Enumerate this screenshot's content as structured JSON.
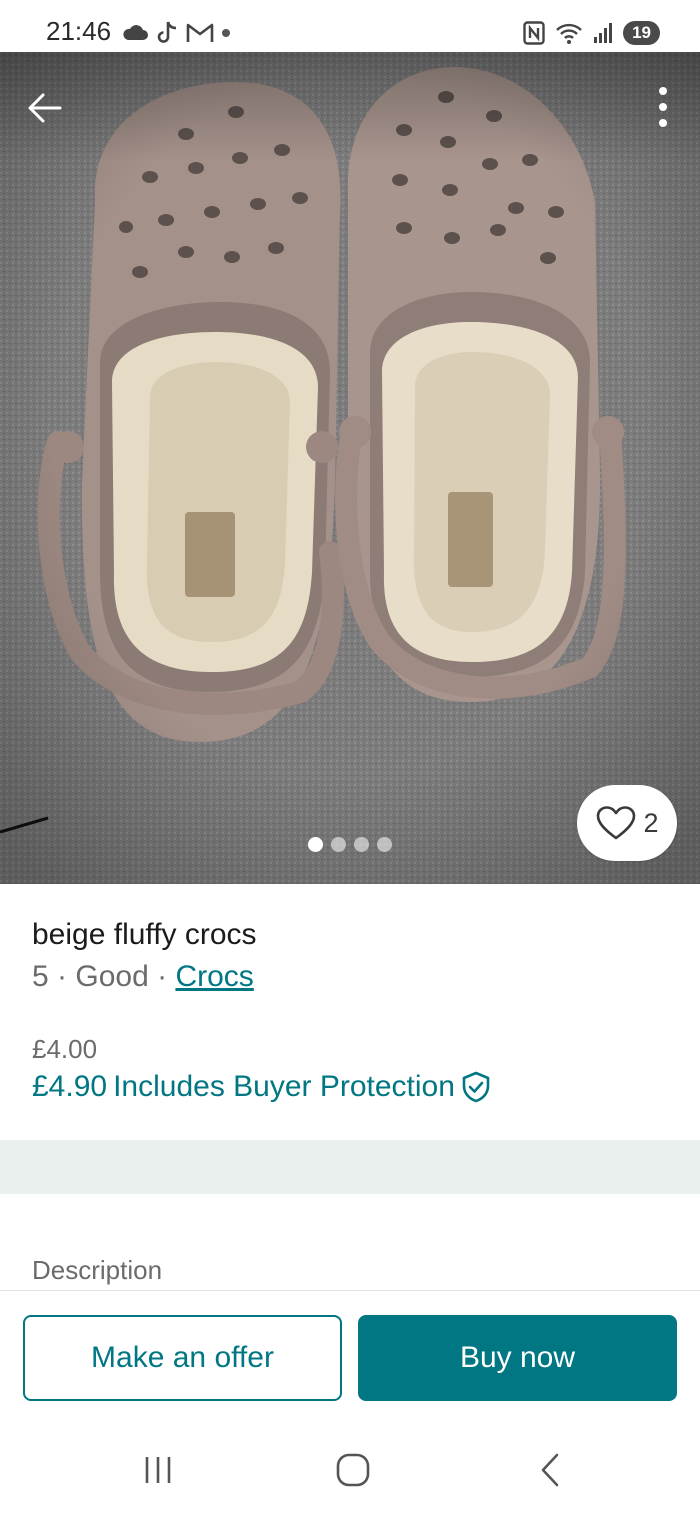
{
  "status_bar": {
    "time": "21:46",
    "left_icons": [
      "cloud-icon",
      "tiktok-icon",
      "gmail-icon",
      "dot-icon"
    ],
    "right_icons": [
      "nfc-icon",
      "wifi-icon",
      "signal-icon"
    ],
    "battery": "19"
  },
  "photo": {
    "alt_subject": "beige fluffy crocs photo",
    "favorites_count": "2",
    "image_count": 4,
    "active_index": 0
  },
  "item": {
    "title": "beige fluffy crocs",
    "size": "5",
    "separator": "·",
    "condition": "Good",
    "brand": "Crocs",
    "price": "£4.00",
    "total_price": "£4.90",
    "buyer_protection": "Includes Buyer Protection"
  },
  "description": {
    "label": "Description"
  },
  "actions": {
    "make_offer": "Make an offer",
    "buy_now": "Buy now"
  },
  "colors": {
    "accent": "#007782",
    "band": "#eaf0ee"
  }
}
